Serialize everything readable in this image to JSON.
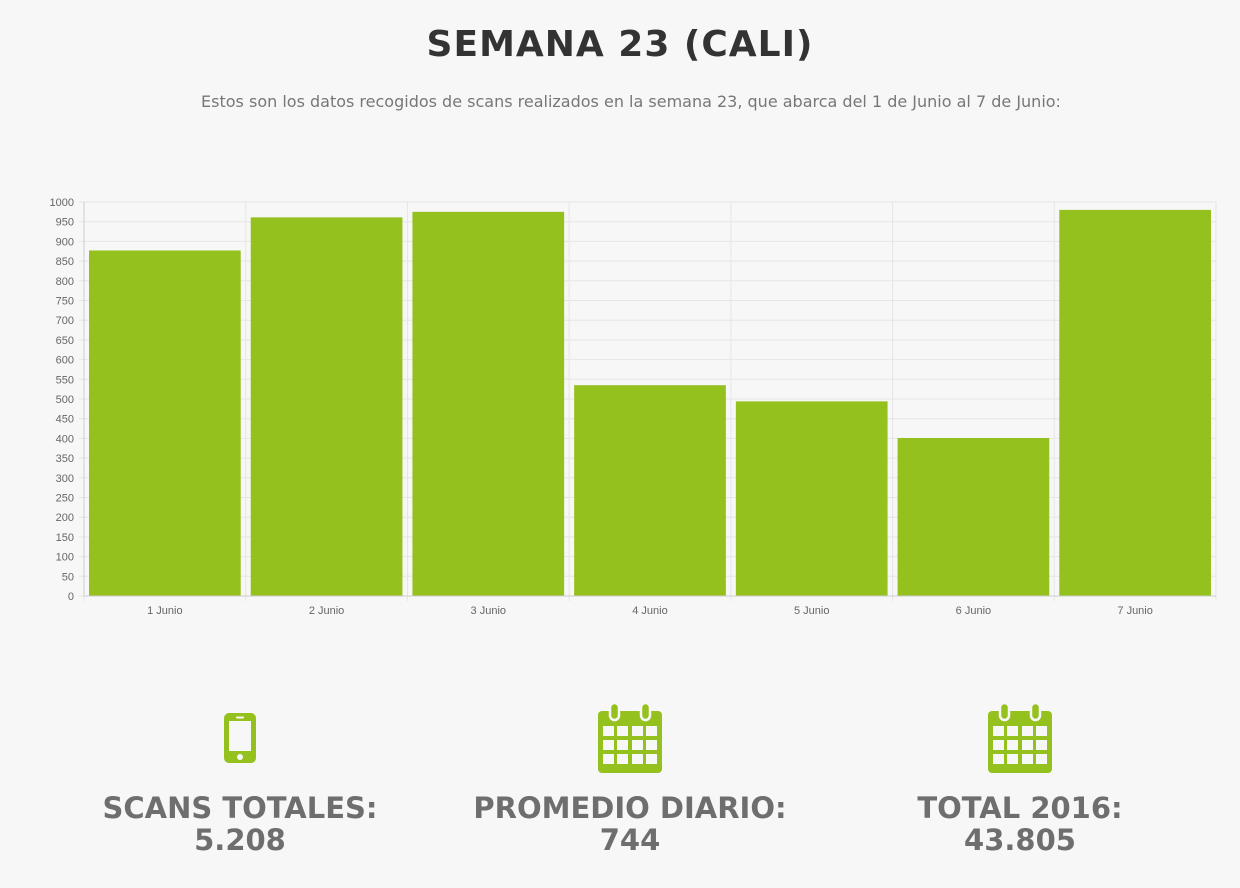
{
  "header": {
    "title": "SEMANA 23 (CALI)",
    "subtitle": "Estos son los datos recogidos de scans realizados en la semana 23, que abarca del 1 de Junio al 7 de Junio:"
  },
  "chart_data": {
    "type": "bar",
    "categories": [
      "1 Junio",
      "2 Junio",
      "3 Junio",
      "4 Junio",
      "5 Junio",
      "6 Junio",
      "7 Junio"
    ],
    "values": [
      877,
      961,
      975,
      535,
      494,
      401,
      980
    ],
    "ylim": [
      0,
      1000
    ],
    "ytick_step": 50,
    "grid": true,
    "bar_color": "#95c11f",
    "title": "",
    "xlabel": "",
    "ylabel": ""
  },
  "stats": [
    {
      "icon": "smartphone-icon",
      "label": "SCANS TOTALES:",
      "value": "5.208"
    },
    {
      "icon": "calendar-icon",
      "label": "PROMEDIO DIARIO:",
      "value": "744"
    },
    {
      "icon": "calendar-icon",
      "label": "TOTAL 2016:",
      "value": "43.805"
    }
  ],
  "colors": {
    "accent": "#95c11f",
    "title": "#333333",
    "stat_text": "#6e6e6e"
  }
}
